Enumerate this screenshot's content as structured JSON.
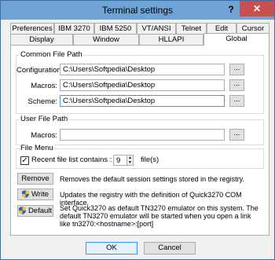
{
  "window": {
    "title": "Terminal settings",
    "help_glyph": "?",
    "close_glyph": "✕"
  },
  "tabs": {
    "row1": [
      "Preferences",
      "IBM 3270",
      "IBM 5250",
      "VT/ANSI",
      "Telnet",
      "Edit",
      "Cursor"
    ],
    "row2": [
      "Display",
      "Window",
      "HLLAPI",
      "Global"
    ],
    "active": "Global"
  },
  "common": {
    "title": "Common File Path",
    "configuration_label": "Configuration:",
    "configuration_value": "C:\\Users\\Softpedia\\Desktop",
    "macros_label": "Macros:",
    "macros_value": "C:\\Users\\Softpedia\\Desktop",
    "scheme_label": "Scheme:",
    "scheme_value": "C:\\Users\\Softpedia\\Desktop",
    "browse_label": "..."
  },
  "user": {
    "title": "User File Path",
    "macros_label": "Macros:",
    "macros_value": "",
    "browse_label": "..."
  },
  "filemenu": {
    "title": "File Menu",
    "checkbox_label": "Recent file list contains :",
    "checked": true,
    "count": "9",
    "unit": "file(s)"
  },
  "actions": {
    "remove_label": "Remove",
    "remove_desc": "Removes the default session settings stored in the registry.",
    "write_label": "Write",
    "write_desc": "Updates the registry with the definition of Quick3270 COM interface.",
    "default_label": "Default",
    "default_desc": "Set Quick3270 as default TN3270 emulator on this system. The default TN3270 emulator will be started when you open a link like tn3270:<hostname>:[port]"
  },
  "footer": {
    "ok_label": "OK",
    "cancel_label": "Cancel"
  }
}
